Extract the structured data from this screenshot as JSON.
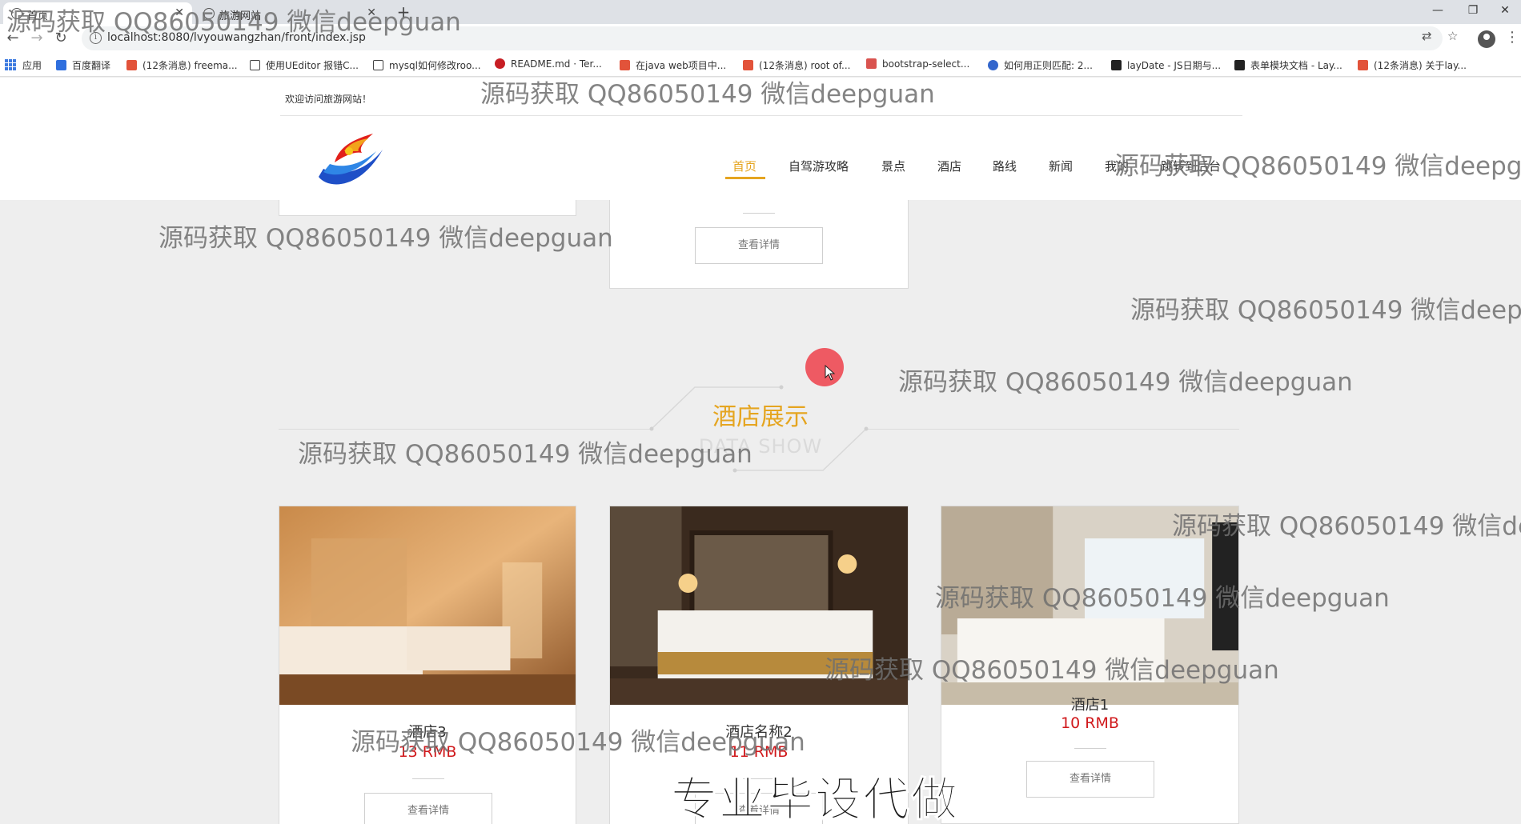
{
  "browser": {
    "tabs": [
      {
        "title": "首页",
        "active": true
      },
      {
        "title": "旅游网站",
        "active": false
      }
    ],
    "url": "localhost:8080/lvyouwangzhan/front/index.jsp",
    "bookmarks": [
      {
        "label": "应用",
        "icon": "apps-grid-icon"
      },
      {
        "label": "百度翻译",
        "icon": "translate-icon"
      },
      {
        "label": "(12条消息) freema...",
        "icon": "csdn-icon"
      },
      {
        "label": "使用UEditor 报错C...",
        "icon": "link-icon"
      },
      {
        "label": "mysql如何修改roo...",
        "icon": "link-icon"
      },
      {
        "label": "README.md · Ter...",
        "icon": "gitee-icon"
      },
      {
        "label": "在java web项目中...",
        "icon": "csdn-icon"
      },
      {
        "label": "(12条消息) root of...",
        "icon": "csdn-icon"
      },
      {
        "label": "bootstrap-select...",
        "icon": "bootstrap-icon"
      },
      {
        "label": "如何用正则匹配: 2...",
        "icon": "baidu-icon"
      },
      {
        "label": "layDate - JS日期与...",
        "icon": "layui-icon"
      },
      {
        "label": "表单模块文档 - Lay...",
        "icon": "layui-icon"
      },
      {
        "label": "(12条消息) 关于lay...",
        "icon": "csdn-icon"
      }
    ]
  },
  "header": {
    "welcome": "欢迎访问旅游网站！",
    "nav": [
      {
        "label": "首页",
        "active": true
      },
      {
        "label": "自驾游攻略"
      },
      {
        "label": "景点"
      },
      {
        "label": "酒店"
      },
      {
        "label": "路线"
      },
      {
        "label": "新闻"
      },
      {
        "label": "我的"
      },
      {
        "label": "跳转到后台"
      }
    ]
  },
  "section": {
    "title": "酒店展示",
    "subtitle": "DATA SHOW"
  },
  "detail_button": "查看详情",
  "hotels": [
    {
      "name": "酒店3",
      "price": "13 RMB"
    },
    {
      "name": "酒店名称2",
      "price": "11 RMB"
    },
    {
      "name": "酒店1",
      "price": "10 RMB"
    }
  ],
  "watermark": "源码获取 QQ86050149 微信deepguan",
  "overlay_caption": "专业毕设代做",
  "colors": {
    "accent": "#e5a520",
    "price": "#d0191c",
    "page_bg": "#eeeeee"
  }
}
